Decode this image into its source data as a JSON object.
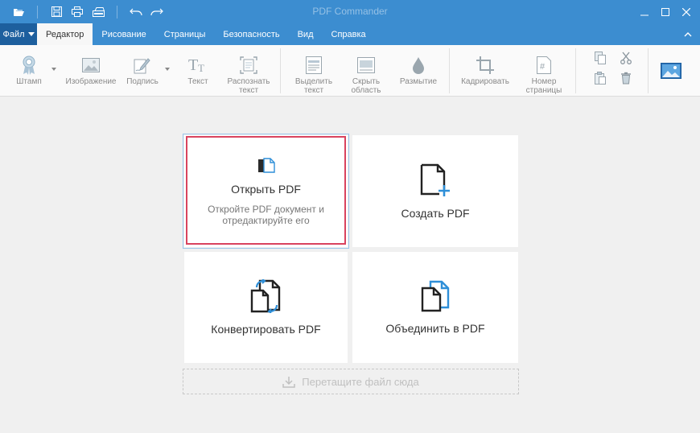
{
  "window": {
    "title": "PDF Commander"
  },
  "quick_access": [
    "open-folder-icon",
    "save-icon",
    "print-icon",
    "scan-icon",
    "undo-icon",
    "redo-icon"
  ],
  "menu": {
    "file_label": "Файл",
    "tabs": [
      "Редактор",
      "Рисование",
      "Страницы",
      "Безопасность",
      "Вид",
      "Справка"
    ],
    "active_tab": "Редактор"
  },
  "ribbon": {
    "stamp": "Штамп",
    "image": "Изображение",
    "signature": "Подпись",
    "text": "Текст",
    "ocr_line1": "Распознать",
    "ocr_line2": "текст",
    "select_line1": "Выделить",
    "select_line2": "текст",
    "hide_line1": "Скрыть",
    "hide_line2": "область",
    "blur": "Размытие",
    "crop": "Кадрировать",
    "pagenum_line1": "Номер",
    "pagenum_line2": "страницы"
  },
  "cards": {
    "open": {
      "title": "Открыть PDF",
      "desc": "Откройте PDF документ и отредактируйте его"
    },
    "create": {
      "title": "Создать PDF"
    },
    "convert": {
      "title": "Конвертировать PDF"
    },
    "merge": {
      "title": "Объединить в PDF"
    }
  },
  "dropzone": {
    "label": "Перетащите файл сюда"
  },
  "colors": {
    "titlebar": "#3c8dd0",
    "file_tab": "#1d5f9e",
    "accent_icon": "#2f8fd8",
    "selection": "#d9435e"
  }
}
